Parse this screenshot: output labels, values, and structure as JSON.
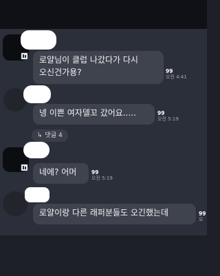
{
  "messages": [
    {
      "text": "로얄님이 클럽 나갔다가 다시\n오신건가용?",
      "read": "99",
      "time": "오전 4:41"
    },
    {
      "text": "넹 이쁜 여자델꼬 갔어요.....",
      "read": "99",
      "time": "오전 5:19"
    },
    {
      "text": "네에? 어머",
      "read": "99",
      "time": "오전 5:19"
    },
    {
      "text": "로얄이랑 다른 래퍼분들도 오긴했는데",
      "read": "99",
      "time": "오"
    }
  ],
  "replies": {
    "arrow_icon": "reply-arrow-icon",
    "label": "댓글 4",
    "arrow": "↳"
  }
}
